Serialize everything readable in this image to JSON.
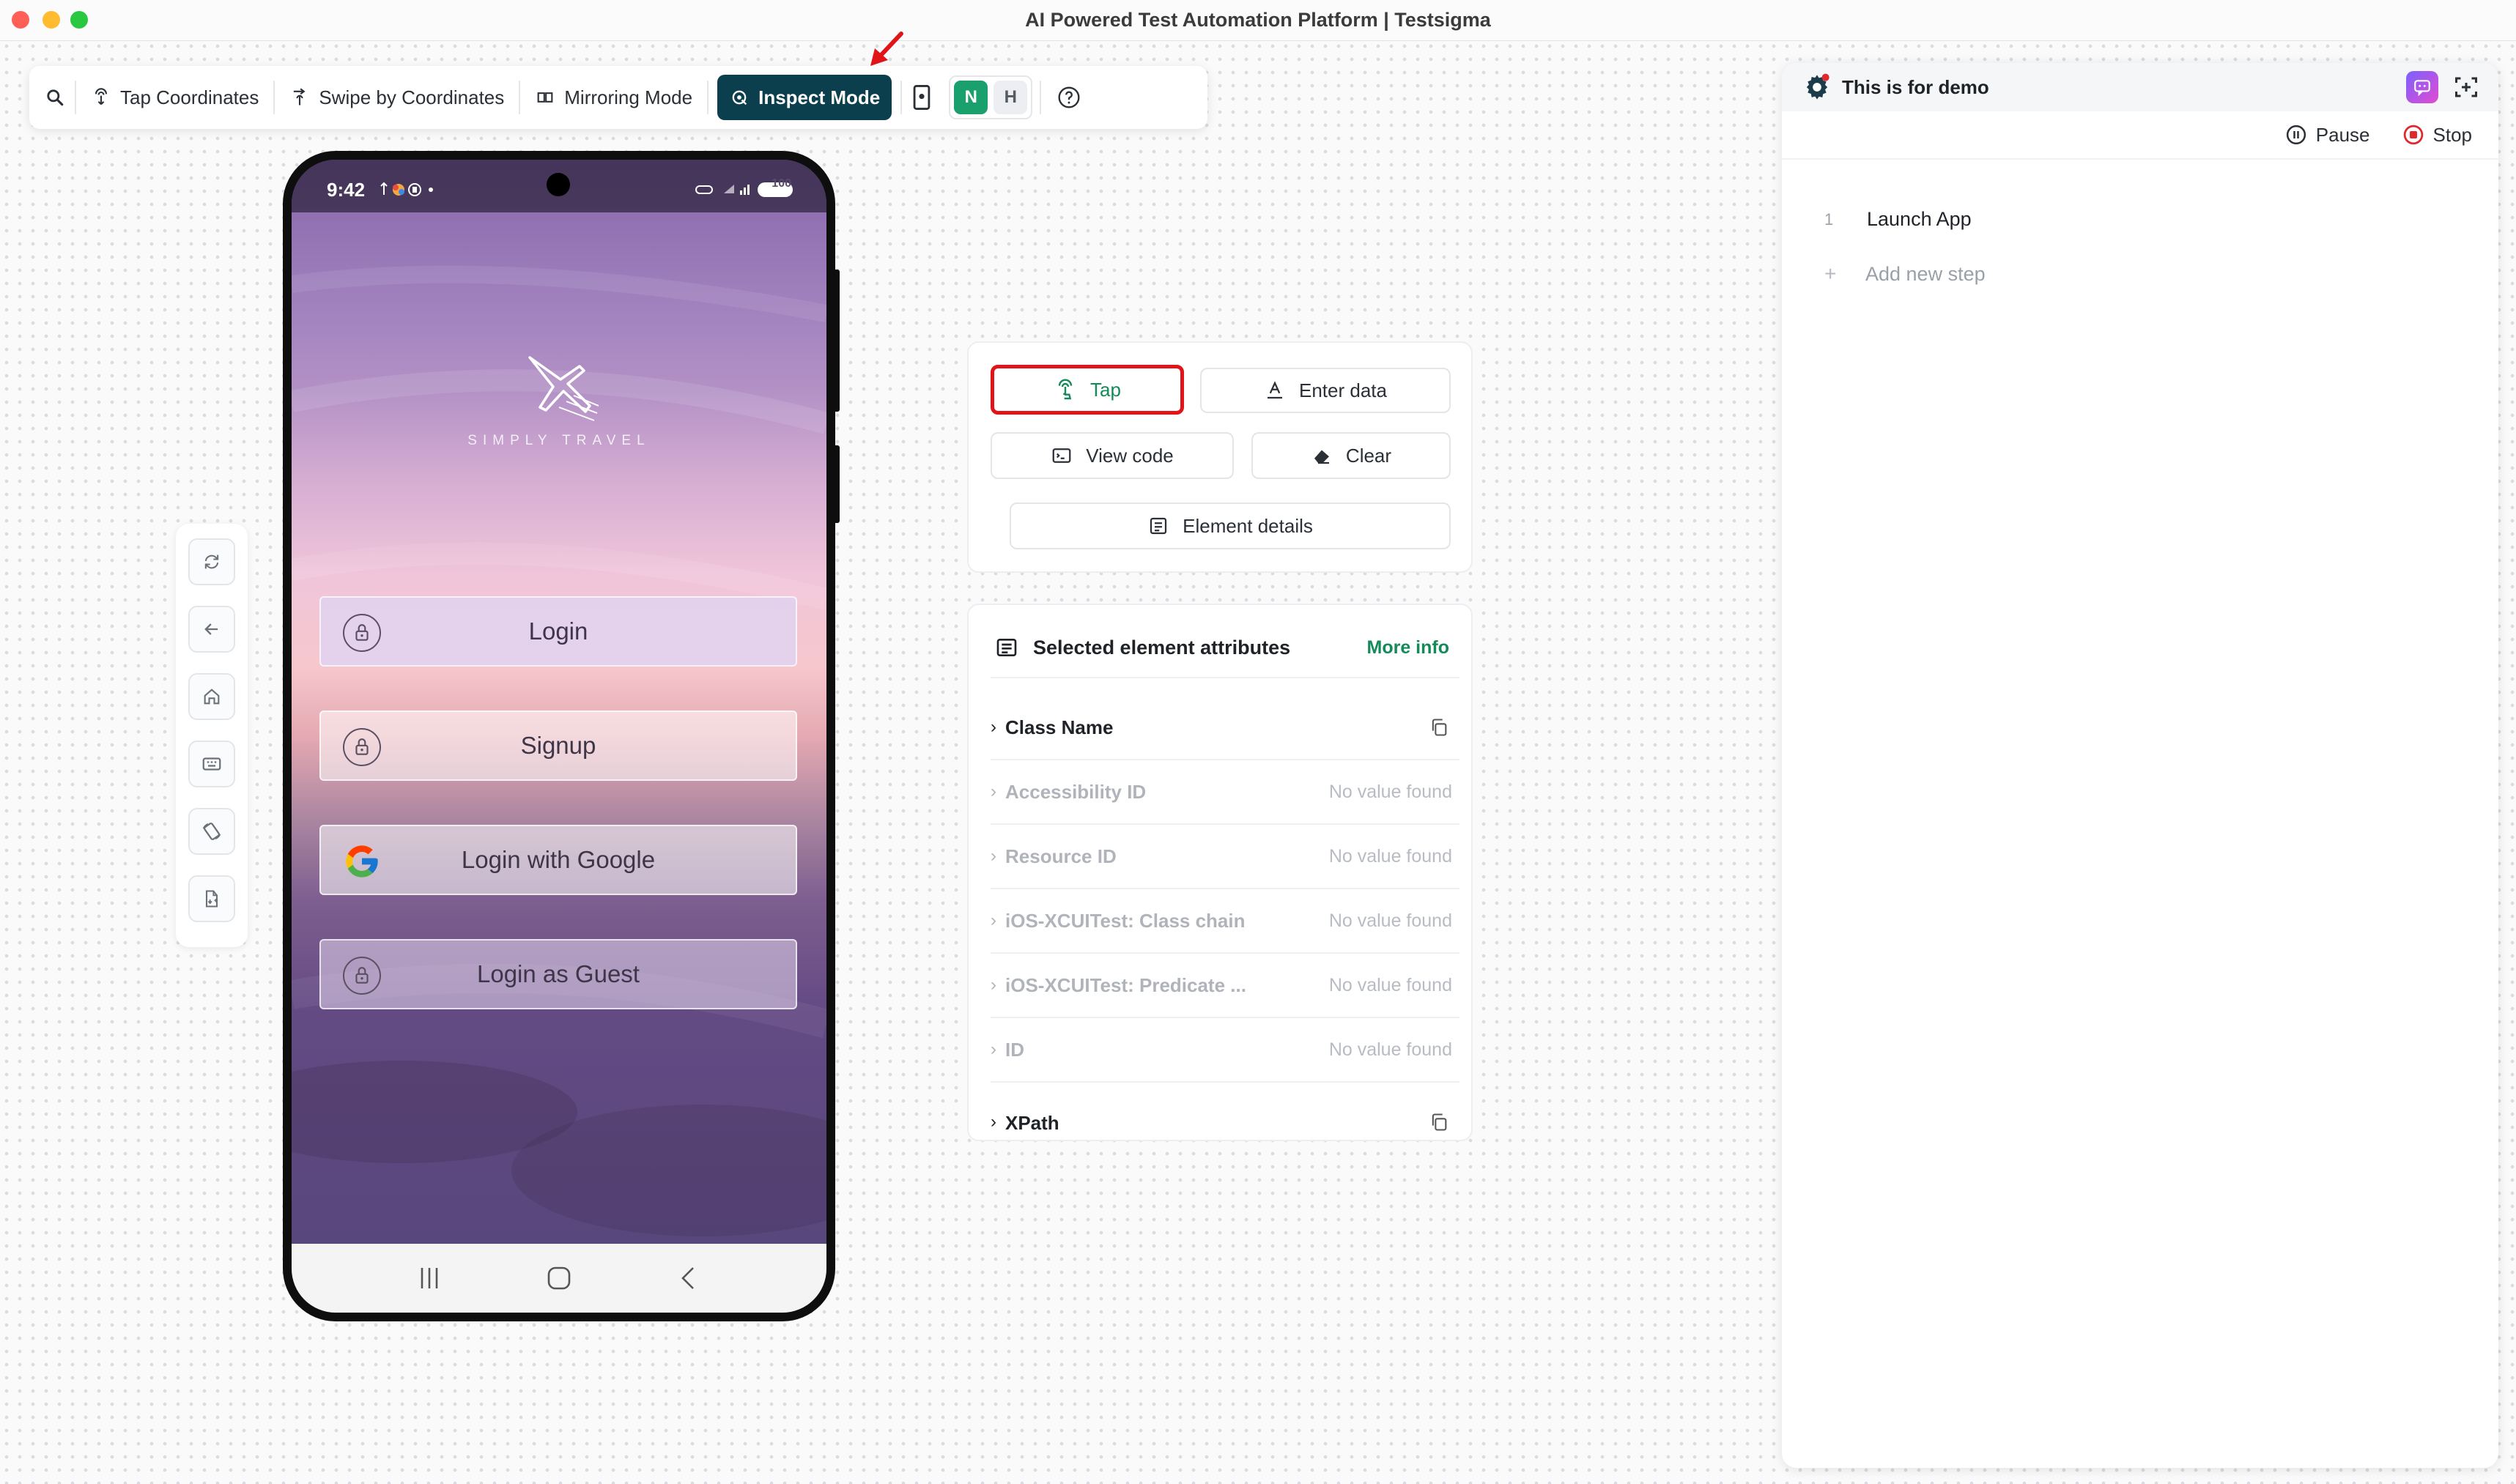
{
  "window": {
    "title": "AI Powered Test Automation Platform | Testsigma"
  },
  "toolbar": {
    "tap_coordinates": "Tap Coordinates",
    "swipe_by_coordinates": "Swipe by Coordinates",
    "mirroring_mode": "Mirroring Mode",
    "inspect_mode": "Inspect Mode",
    "mode_n": "N",
    "mode_h": "H"
  },
  "phone": {
    "time": "9:42",
    "battery": "100",
    "brand": "SIMPLY TRAVEL",
    "buttons": [
      {
        "label": "Login",
        "icon": "lock-icon"
      },
      {
        "label": "Signup",
        "icon": "lock-icon"
      },
      {
        "label": "Login with Google",
        "icon": "google-icon"
      },
      {
        "label": "Login as Guest",
        "icon": "lock-icon"
      }
    ]
  },
  "actions": {
    "tap": "Tap",
    "enter_data": "Enter data",
    "view_code": "View code",
    "clear": "Clear",
    "element_details": "Element details"
  },
  "attributes": {
    "title": "Selected element attributes",
    "more_info": "More info",
    "class_name": "Class Name",
    "rows": [
      {
        "name": "Accessibility ID",
        "value": "No value found"
      },
      {
        "name": "Resource ID",
        "value": "No value found"
      },
      {
        "name": "iOS-XCUITest: Class chain",
        "value": "No value found"
      },
      {
        "name": "iOS-XCUITest: Predicate ...",
        "value": "No value found"
      },
      {
        "name": "ID",
        "value": "No value found"
      }
    ],
    "last_row": "XPath"
  },
  "panel": {
    "title": "This is for demo",
    "pause": "Pause",
    "stop": "Stop",
    "steps": [
      {
        "num": "1",
        "label": "Launch App"
      }
    ],
    "add_step": "Add new step"
  },
  "colors": {
    "inspect_bg": "#0c3f4d",
    "tap_highlight": "#e1141a",
    "accent_green": "#138a5a",
    "stop_red": "#e0282e"
  }
}
